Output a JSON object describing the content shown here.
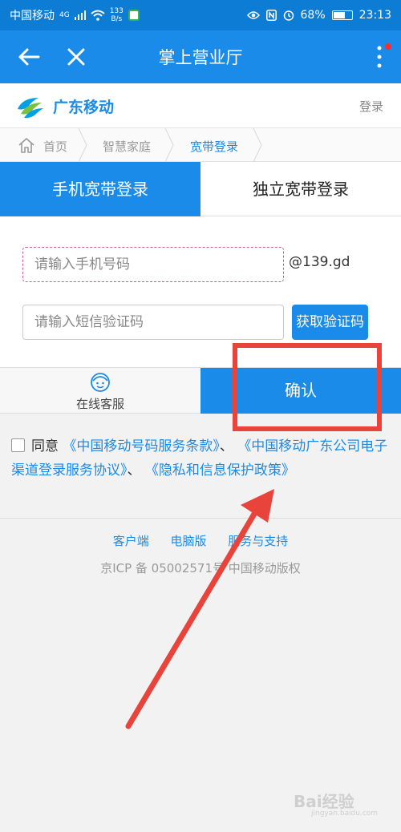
{
  "status_bar": {
    "carrier": "中国移动",
    "signal": "4G",
    "speed_value": "133",
    "speed_unit": "B/s",
    "battery": "68%",
    "battery_level": 0.68,
    "time": "23:13"
  },
  "app_bar": {
    "title": "掌上营业厅",
    "back_icon": "arrow-left-icon",
    "close_icon": "close-icon",
    "menu_icon": "more-vertical-icon",
    "notification_color": "#ff2d2d"
  },
  "brand": {
    "name": "广东移动",
    "login": "登录"
  },
  "breadcrumb": {
    "items": [
      "首页",
      "智慧家庭",
      "宽带登录"
    ]
  },
  "tabs": [
    {
      "label": "手机宽带登录",
      "active": true
    },
    {
      "label": "独立宽带登录",
      "active": false
    }
  ],
  "form": {
    "phone_placeholder": "请输入手机号码",
    "phone_suffix": "@139.gd",
    "sms_placeholder": "请输入短信验证码",
    "sms_button": "获取验证码"
  },
  "actions": {
    "service_label": "在线客服",
    "confirm_label": "确认"
  },
  "agreement": {
    "prefix": "同意",
    "link1": "《中国移动号码服务条款》",
    "sep1": "、",
    "link2": "《中国移动广东公司电子渠道登录服务协议》",
    "sep2": "、",
    "link3": "《隐私和信息保护政策》"
  },
  "footer": {
    "links": [
      "客户端",
      "电脑版",
      "服务与支持"
    ],
    "icp": "京ICP 备 05002571号  中国移动版权"
  },
  "watermark": {
    "brand": "Bai",
    "brand_suffix": "经验",
    "domain": "jingyan.baidu.com"
  },
  "colors": {
    "accent": "#1a8be8",
    "highlight": "#e8443c"
  }
}
